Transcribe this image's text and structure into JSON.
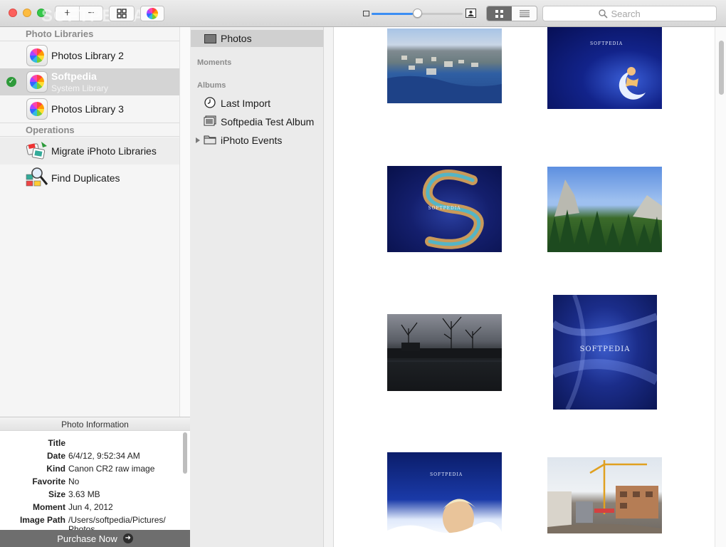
{
  "window": {
    "watermark": "SOFTPEDIA"
  },
  "toolbar": {
    "add_label": "+",
    "remove_label": "−",
    "search_placeholder": "Search",
    "zoom_slider_value": 0.5,
    "view_mode": "grid"
  },
  "sidebar": {
    "libraries_header": "Photo Libraries",
    "libraries": [
      {
        "name": "Photos Library 2",
        "subtitle": "",
        "selected": false
      },
      {
        "name": "Softpedia",
        "subtitle": "System Library",
        "selected": true
      },
      {
        "name": "Photos Library 3",
        "subtitle": "",
        "selected": false
      }
    ],
    "operations_header": "Operations",
    "operations": [
      {
        "name": "Migrate iPhoto Libraries"
      },
      {
        "name": "Find Duplicates"
      }
    ]
  },
  "info": {
    "title": "Photo Information",
    "rows": [
      {
        "key": "Title",
        "value": ""
      },
      {
        "key": "Date",
        "value": "6/4/12, 9:52:34 AM"
      },
      {
        "key": "Kind",
        "value": "Canon CR2 raw image"
      },
      {
        "key": "Favorite",
        "value": "No"
      },
      {
        "key": "Size",
        "value": "3.63 MB"
      },
      {
        "key": "Moment",
        "value": "Jun 4, 2012"
      },
      {
        "key": "Image Path",
        "value": "/Users/softpedia/Pictures/"
      },
      {
        "key": "",
        "value": "Photos"
      }
    ],
    "purchase_label": "Purchase Now"
  },
  "source": {
    "photos_label": "Photos",
    "moments_header": "Moments",
    "albums_header": "Albums",
    "albums": [
      {
        "name": "Last Import",
        "icon": "clock-icon"
      },
      {
        "name": "Softpedia Test Album",
        "icon": "album-icon"
      },
      {
        "name": "iPhoto Events",
        "icon": "folder-icon"
      }
    ]
  },
  "photos": [
    {
      "description": "coastal town",
      "text": ""
    },
    {
      "description": "softpedia moon",
      "text": "SOFTPEDIA"
    },
    {
      "description": "softpedia s swirl",
      "text": "SOFTPEDIA"
    },
    {
      "description": "mountain forest",
      "text": ""
    },
    {
      "description": "dark trees lake",
      "text": ""
    },
    {
      "description": "softpedia aurora",
      "text": "SOFTPEDIA"
    },
    {
      "description": "softpedia woman",
      "text": "SOFTPEDIA"
    },
    {
      "description": "construction site",
      "text": ""
    }
  ],
  "colors": {
    "accent": "#3b8ef3",
    "selected_row": "#d4d4d4",
    "check": "#2e9a3a",
    "purchase_bar": "#6e6e6e"
  }
}
